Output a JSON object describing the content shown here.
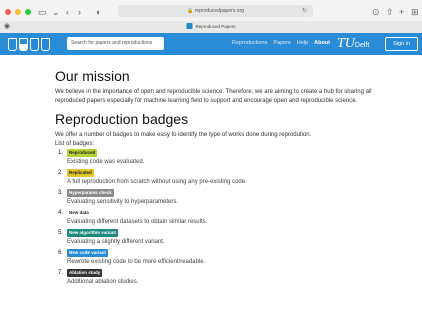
{
  "browser": {
    "url": "reproducedpapers.org",
    "tab_title": "Reproduced Papers"
  },
  "navbar": {
    "search_placeholder": "Search for papers and reproductions",
    "links": [
      "Reproductions",
      "Papers",
      "Help",
      "About"
    ],
    "active_link": "About",
    "brand_main": "TU",
    "brand_sub": "Delft",
    "signin_label": "Sign in"
  },
  "mission": {
    "title": "Our mission",
    "text": "We believe in the importance of open and reproducible science. Therefore, we are aiming to create a hub for sharing all reproduced papers especially for machine learning field to support and encourage open and reproducible science."
  },
  "badges": {
    "title": "Reproduction badges",
    "intro": "We offer a number of badges to make easy to identify the type of works done during reprodution.",
    "list_label": "List of badges:",
    "items": [
      {
        "num": "1.",
        "label": "Reproduced",
        "desc": "Existing code was evaluated.",
        "color": "#b5d334"
      },
      {
        "num": "2.",
        "label": "Replicated",
        "desc": "A full reproduction from scratch without using any pre-existing code.",
        "color": "#e0c52b"
      },
      {
        "num": "3.",
        "label": "Hyperparams check",
        "desc": "Evaluating sensitivity to hyperparameters.",
        "color": "#8a8a8a"
      },
      {
        "num": "4.",
        "label": "New data",
        "desc": "Evaluating different datasets to obtain similar results.",
        "color": "#ffffff"
      },
      {
        "num": "5.",
        "label": "New algorithm variant",
        "desc": "Evaluating a slightly different variant.",
        "color": "#1e8a7e"
      },
      {
        "num": "6.",
        "label": "New code variant",
        "desc": "Rewrote existing code to be more efficient/readable.",
        "color": "#2a8bd6"
      },
      {
        "num": "7.",
        "label": "Ablation study",
        "desc": "Additional ablation studies.",
        "color": "#333333"
      }
    ]
  }
}
